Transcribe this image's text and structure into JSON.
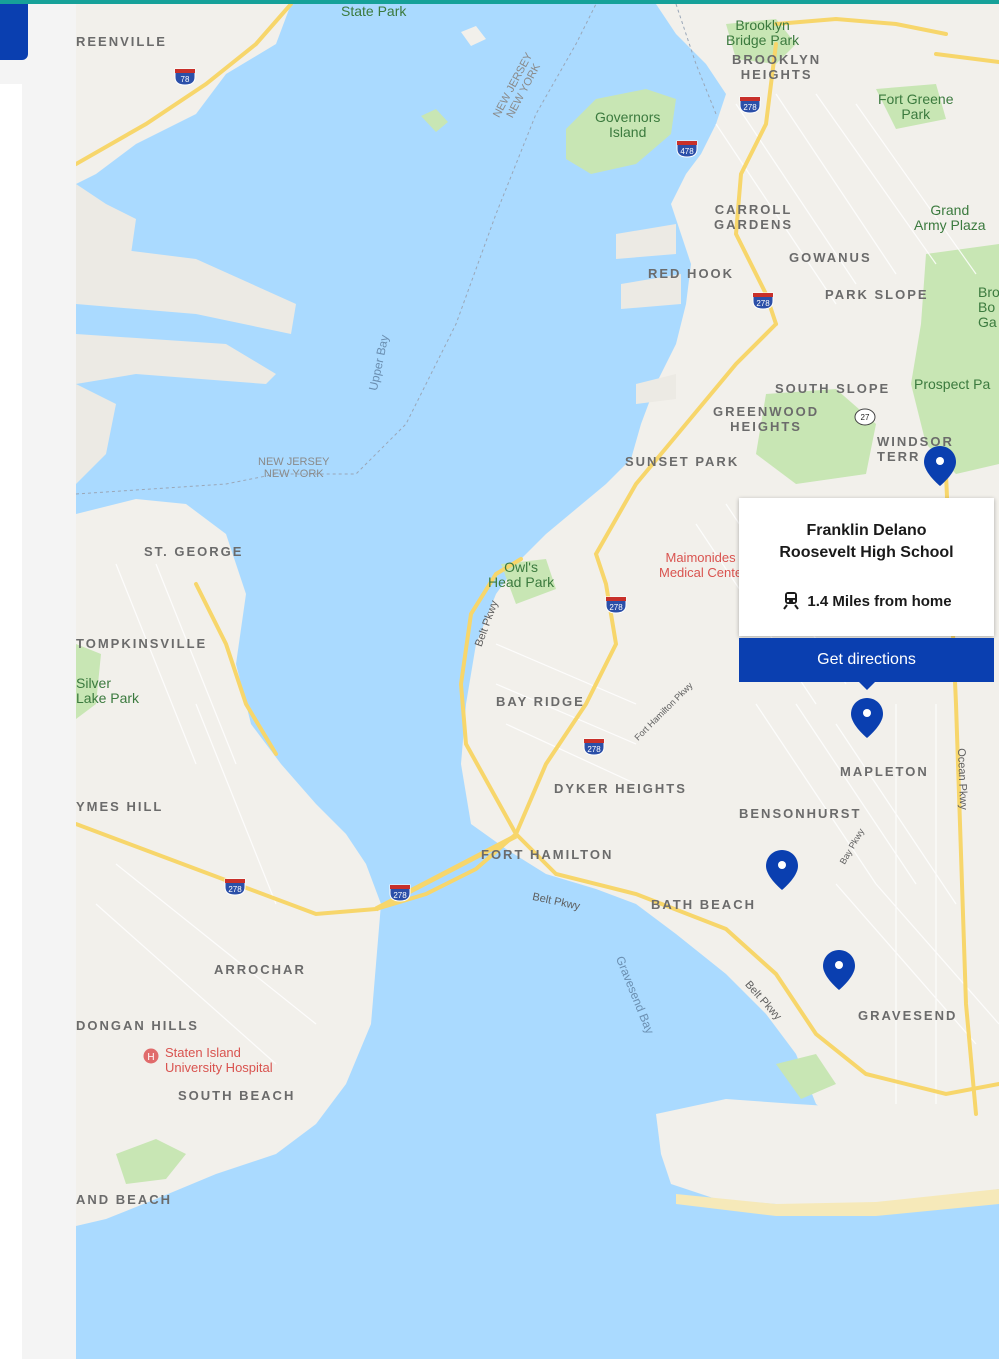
{
  "map": {
    "neighborhoods": {
      "greenville": "REENVILLE",
      "st_george": "ST. GEORGE",
      "tompkinsville": "TOMPKINSVILLE",
      "ymes_hill": "YMES HILL",
      "arrochar": "ARROCHAR",
      "dongan_hills": "DONGAN HILLS",
      "south_beach": "SOUTH BEACH",
      "midland_beach": "AND BEACH",
      "brooklyn_heights": "BROOKLYN\nHEIGHTS",
      "carroll_gardens": "CARROLL\nGARDENS",
      "gowanus": "GOWANUS",
      "red_hook": "RED HOOK",
      "park_slope": "PARK SLOPE",
      "south_slope": "SOUTH SLOPE",
      "greenwood_heights": "GREENWOOD\nHEIGHTS",
      "windsor_terrace": "WINDSOR\nTERR",
      "sunset_park": "SUNSET PARK",
      "bay_ridge": "BAY RIDGE",
      "dyker_heights": "DYKER HEIGHTS",
      "fort_hamilton": "FORT HAMILTON",
      "bensonhurst": "BENSONHURST",
      "mapleton": "MAPLETON",
      "bath_beach": "BATH BEACH",
      "gravesend": "GRAVESEND"
    },
    "parks": {
      "state_park": "State Park",
      "brooklyn_bridge_park": "Brooklyn\nBridge Park",
      "fort_greene_park": "Fort Greene\nPark",
      "governors_island": "Governors\nIsland",
      "grand_army_plaza": "Grand\nArmy Plaza",
      "prospect_park": "Prospect Pa",
      "brooklyn_botanic": "Bro\nBo\nGa",
      "owls_head_park": "Owl's\nHead Park",
      "silver_lake_park": "Silver\nLake Park"
    },
    "water": {
      "upper_bay": "Upper Bay",
      "gravesend_bay": "Gravesend Bay"
    },
    "borders": {
      "nj_ny_1": "NEW JERSEY\nNEW YORK",
      "nj_ny_2": "NEW JERSEY\nNEW YORK"
    },
    "pois": {
      "maimonides": "Maimonides\nMedical Cente",
      "si_hospital": "Staten Island\nUniversity Hospital"
    },
    "roads": {
      "belt_pkwy_1": "Belt Pkwy",
      "belt_pkwy_2": "Belt Pkwy",
      "belt_pkwy_3": "Belt Pkwy",
      "ocean_pkwy": "Ocean Pkwy",
      "fort_hamilton_pkwy": "Fort Hamilton Pkwy",
      "bay_pkwy": "Bay Pkwy"
    },
    "shields": {
      "i278_a": "278",
      "i278_b": "278",
      "i278_c": "278",
      "i278_d": "278",
      "i278_e": "278",
      "i278_f": "278",
      "i278_g": "278",
      "i478": "478",
      "i78": "78",
      "ny27": "27"
    }
  },
  "popup": {
    "title": "Franklin Delano\nRoosevelt High School",
    "distance": "1.4 Miles from home",
    "button_label": "Get directions"
  },
  "colors": {
    "accent": "#0a3fb0",
    "topbar": "#16a199",
    "water": "#aadaff",
    "land": "#f2f0eb",
    "park": "#c8e6b4"
  }
}
